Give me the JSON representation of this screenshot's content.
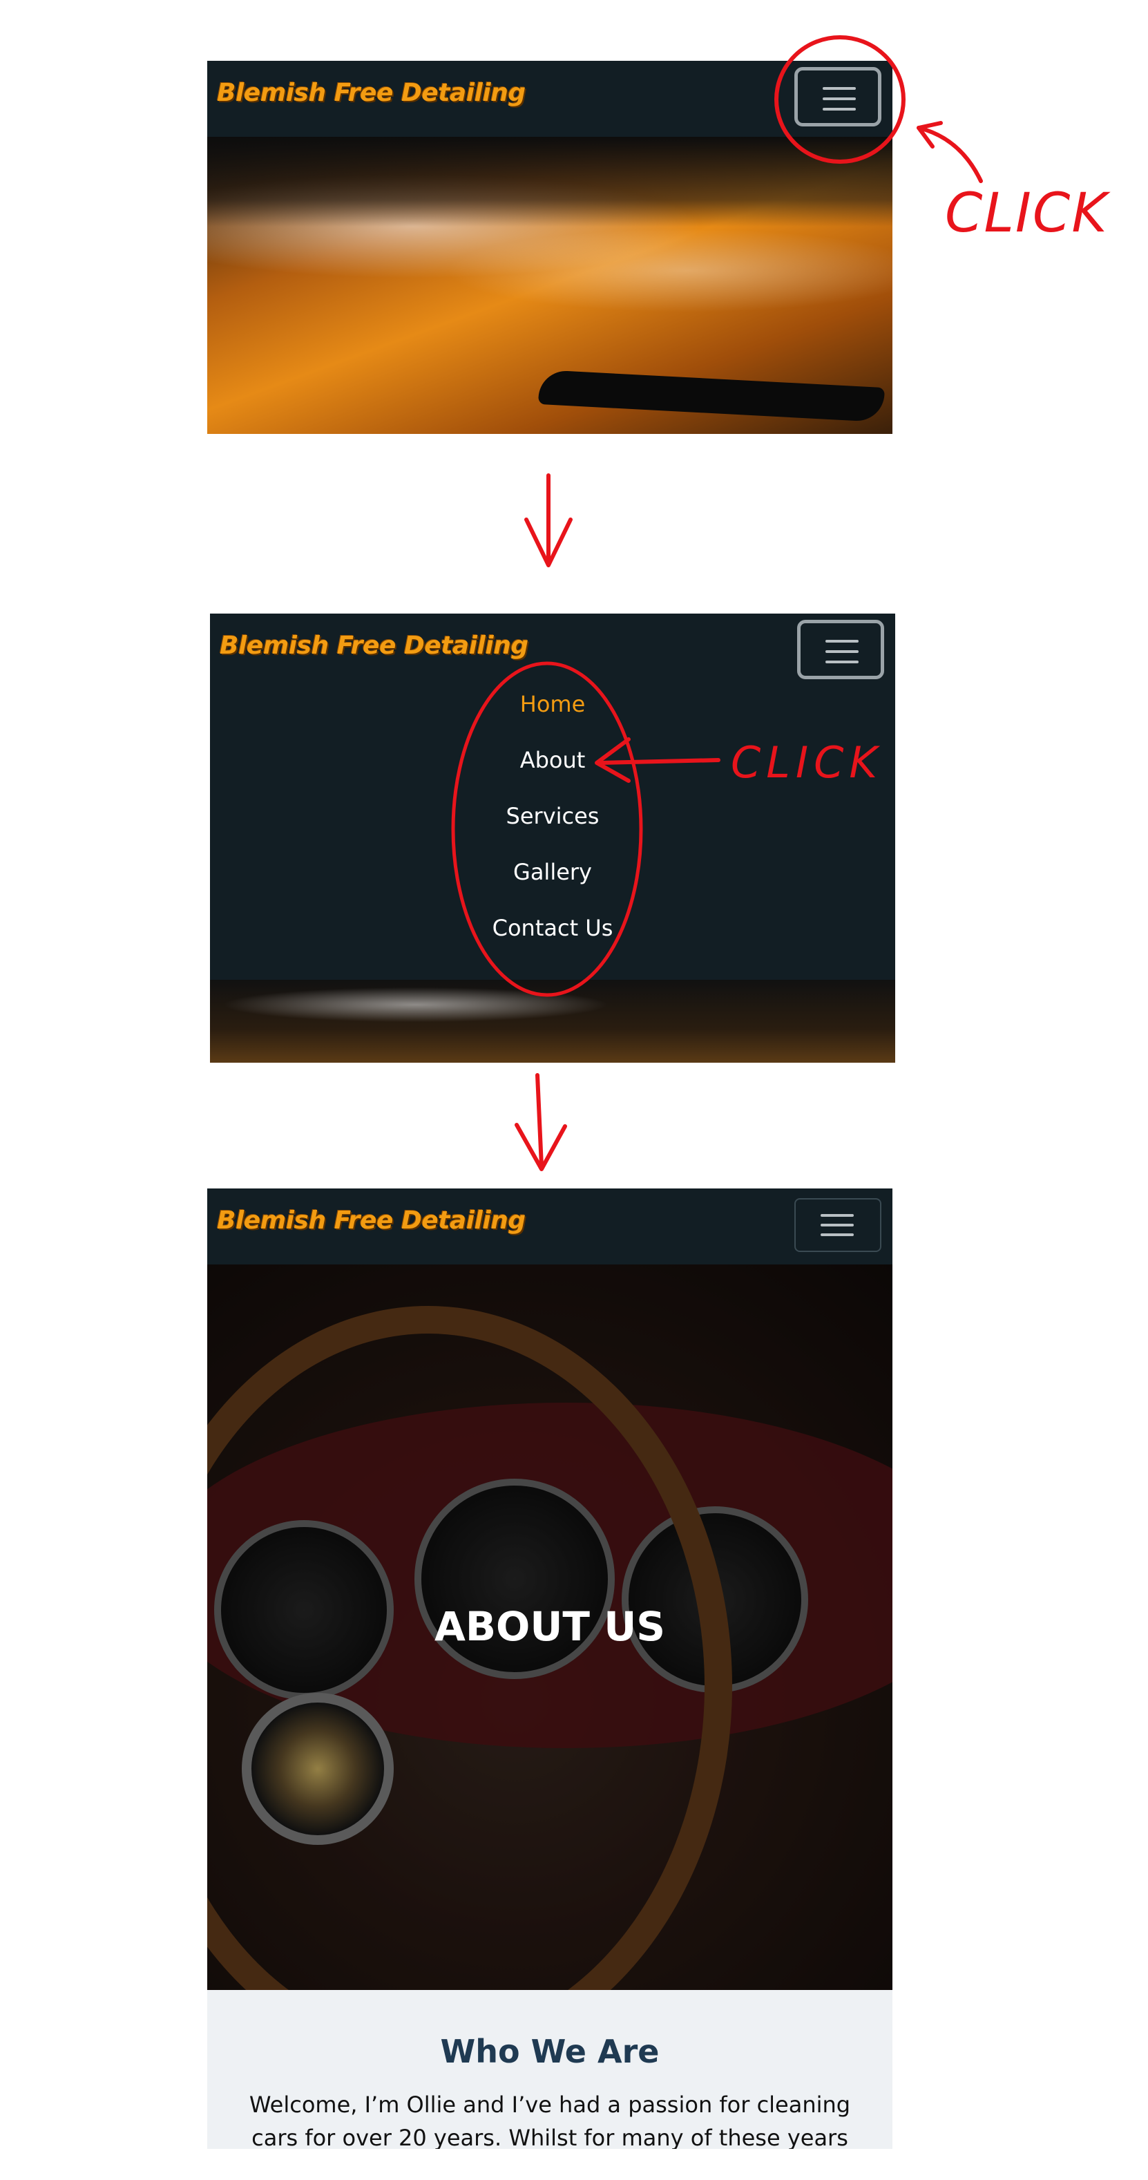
{
  "brand": "Blemish Free Detailing",
  "annotation": {
    "click_label_1": "CLICK",
    "click_label_2": "CLICK",
    "color": "#e8141b"
  },
  "colors": {
    "navbar": "#121e24",
    "brand": "#f39c12",
    "active_link": "#f39c12"
  },
  "menu": {
    "items": [
      {
        "label": "Home",
        "active": true
      },
      {
        "label": "About",
        "active": false
      },
      {
        "label": "Services",
        "active": false
      },
      {
        "label": "Gallery",
        "active": false
      },
      {
        "label": "Contact Us",
        "active": false
      }
    ]
  },
  "about_page": {
    "hero_title": "ABOUT US",
    "section_title": "Who We Are",
    "section_text": "Welcome, I’m Ollie and I’ve had a passion for cleaning cars for over 20 years. Whilst for many of these years this was"
  },
  "icons": {
    "toggler": "hamburger-menu-icon",
    "arrow": "arrow-down-icon"
  }
}
